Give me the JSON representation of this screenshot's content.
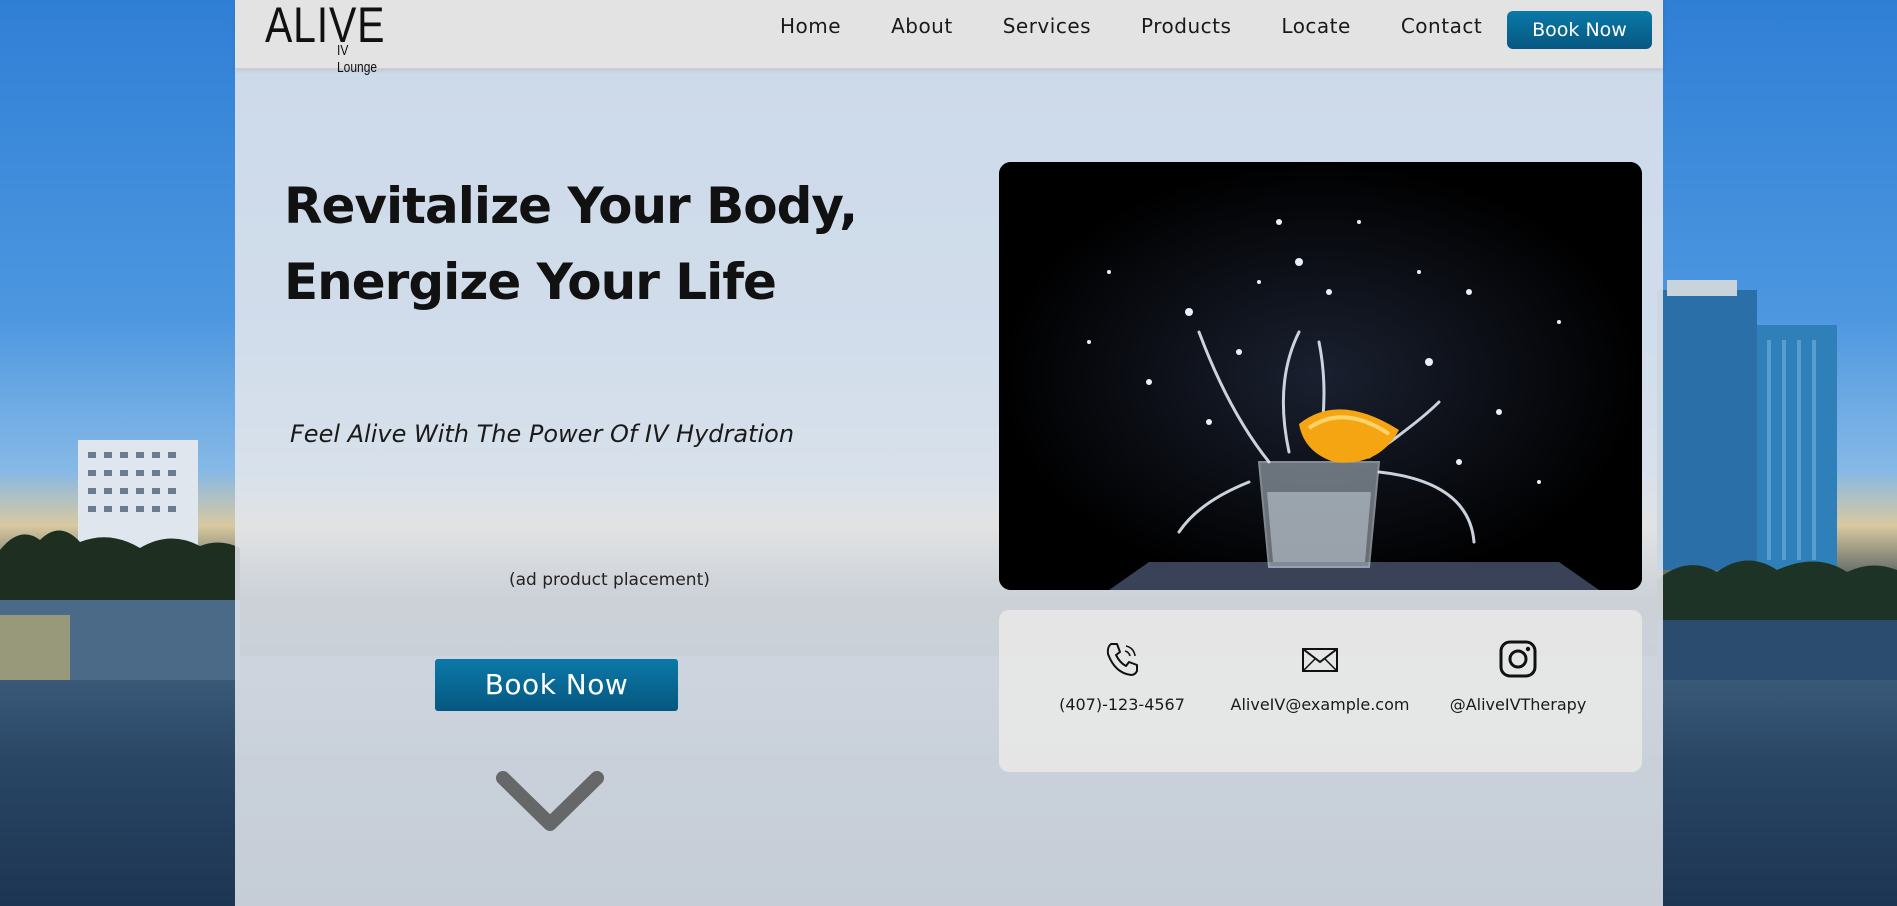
{
  "brand": {
    "logo_main": "ALIVE",
    "logo_sub": "IV Lounge"
  },
  "nav": {
    "items": [
      "Home",
      "About",
      "Services",
      "Products",
      "Locate",
      "Contact"
    ],
    "book_label": "Book Now"
  },
  "hero": {
    "title_line1": "Revitalize Your Body,",
    "title_line2": "Energize Your Life",
    "tagline": "Feel Alive With The Power Of IV Hydration",
    "ad_note": "(ad product placement)",
    "book_label": "Book Now",
    "scroll_icon": "chevron-down-icon"
  },
  "contact": {
    "phone": "(407)-123-4567",
    "email": "AliveIV@example.com",
    "instagram": "@AliveIVTherapy",
    "icons": [
      "phone-icon",
      "mail-icon",
      "instagram-icon"
    ]
  },
  "colors": {
    "accent": "#0b6f9c",
    "panel": "#e2e6ec",
    "text": "#111111"
  }
}
